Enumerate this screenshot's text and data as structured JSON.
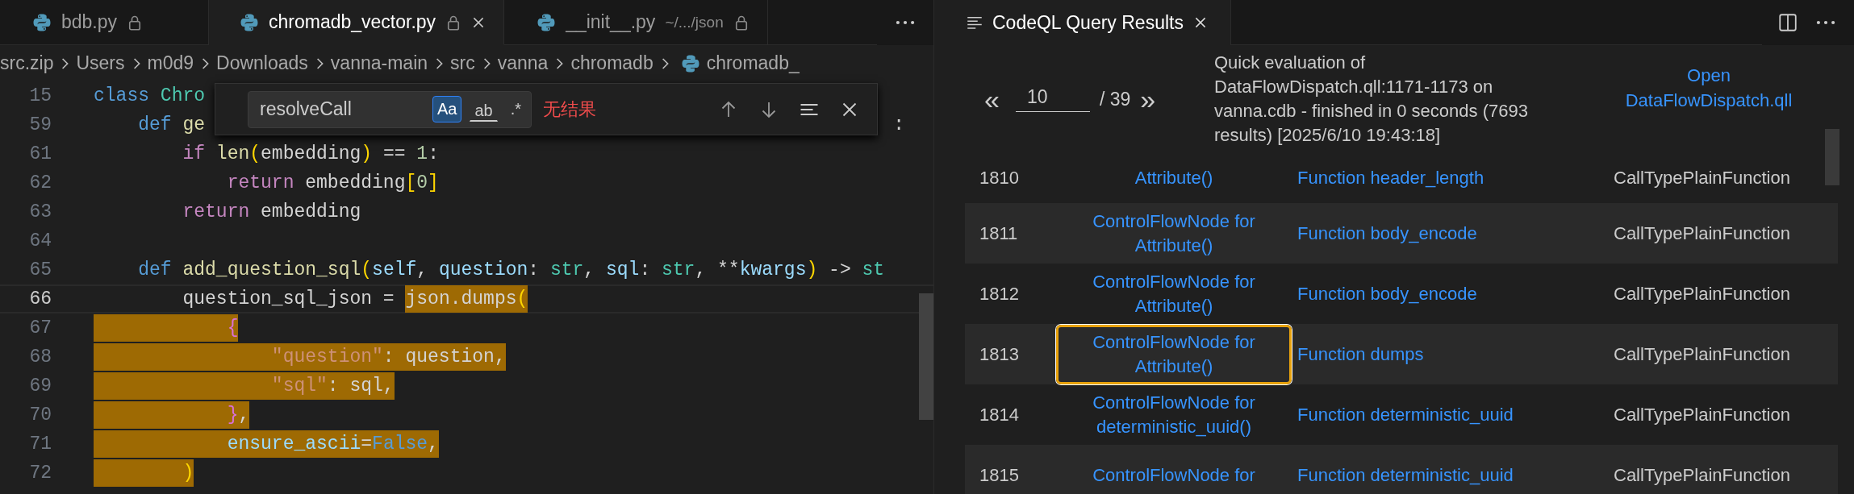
{
  "editor": {
    "tabs": [
      {
        "label": "bdb.py",
        "selected": false,
        "locked": true
      },
      {
        "label": "chromadb_vector.py",
        "selected": true,
        "locked": true
      },
      {
        "label": "__init__.py",
        "description": "~/.../json",
        "selected": false,
        "locked": true
      }
    ],
    "breadcrumb": [
      {
        "label": "src.zip",
        "kind": "folder"
      },
      {
        "label": "Users",
        "kind": "folder"
      },
      {
        "label": "m0d9",
        "kind": "folder"
      },
      {
        "label": "Downloads",
        "kind": "folder"
      },
      {
        "label": "vanna-main",
        "kind": "folder"
      },
      {
        "label": "src",
        "kind": "folder"
      },
      {
        "label": "vanna",
        "kind": "folder"
      },
      {
        "label": "chromadb",
        "kind": "folder"
      },
      {
        "label": "chromadb_",
        "kind": "file"
      }
    ],
    "find": {
      "value": "resolveCall",
      "options": [
        {
          "label": "Aa",
          "selected": true
        },
        {
          "label": "ab",
          "selected": false
        },
        {
          "label": ".*",
          "selected": false
        }
      ],
      "status": "无结果"
    },
    "lines": [
      {
        "number": "15",
        "active": false,
        "tokens": [
          {
            "text": "class ",
            "kind": "keyword",
            "hl": false
          },
          {
            "text": "Chro",
            "kind": "class",
            "hl": false
          }
        ]
      },
      {
        "number": "59",
        "active": false,
        "tail": ":",
        "tokens": [
          {
            "text": "    def ",
            "kind": "keyword",
            "hl": false
          },
          {
            "text": "ge",
            "kind": "function",
            "hl": false
          }
        ]
      },
      {
        "number": "61",
        "active": false,
        "tokens": [
          {
            "text": "        if ",
            "kind": "control",
            "hl": false
          },
          {
            "text": "len",
            "kind": "function",
            "hl": false
          },
          {
            "text": "(",
            "kind": "bracket",
            "hl": false
          },
          {
            "text": "embedding",
            "kind": "plain",
            "hl": false
          },
          {
            "text": ")",
            "kind": "bracket",
            "hl": false
          },
          {
            "text": " == ",
            "kind": "plain",
            "hl": false
          },
          {
            "text": "1",
            "kind": "number",
            "hl": false
          },
          {
            "text": ":",
            "kind": "plain",
            "hl": false
          }
        ]
      },
      {
        "number": "62",
        "active": false,
        "tokens": [
          {
            "text": "            return ",
            "kind": "control",
            "hl": false
          },
          {
            "text": "embedding",
            "kind": "plain",
            "hl": false
          },
          {
            "text": "[",
            "kind": "bracket",
            "hl": false
          },
          {
            "text": "0",
            "kind": "number",
            "hl": false
          },
          {
            "text": "]",
            "kind": "bracket",
            "hl": false
          }
        ]
      },
      {
        "number": "63",
        "active": false,
        "tokens": [
          {
            "text": "        return ",
            "kind": "control",
            "hl": false
          },
          {
            "text": "embedding",
            "kind": "plain",
            "hl": false
          }
        ]
      },
      {
        "number": "64",
        "active": false
      },
      {
        "number": "65",
        "active": false,
        "tokens": [
          {
            "text": "    def ",
            "kind": "keyword",
            "hl": false
          },
          {
            "text": "add_question_sql",
            "kind": "function",
            "hl": false
          },
          {
            "text": "(",
            "kind": "bracket",
            "hl": false
          },
          {
            "text": "self",
            "kind": "param",
            "hl": false
          },
          {
            "text": ", ",
            "kind": "plain",
            "hl": false
          },
          {
            "text": "question",
            "kind": "param",
            "hl": false
          },
          {
            "text": ": ",
            "kind": "plain",
            "hl": false
          },
          {
            "text": "str",
            "kind": "type",
            "hl": false
          },
          {
            "text": ", ",
            "kind": "plain",
            "hl": false
          },
          {
            "text": "sql",
            "kind": "param",
            "hl": false
          },
          {
            "text": ": ",
            "kind": "plain",
            "hl": false
          },
          {
            "text": "str",
            "kind": "type",
            "hl": false
          },
          {
            "text": ", **",
            "kind": "plain",
            "hl": false
          },
          {
            "text": "kwargs",
            "kind": "param",
            "hl": false
          },
          {
            "text": ")",
            "kind": "bracket",
            "hl": false
          },
          {
            "text": " -> ",
            "kind": "plain",
            "hl": false
          },
          {
            "text": "st",
            "kind": "type",
            "hl": false
          }
        ]
      },
      {
        "number": "66",
        "active": true,
        "tokens": [
          {
            "text": "        question_sql_json = ",
            "kind": "plain",
            "hl": false
          },
          {
            "text": "json.dumps",
            "kind": "plain",
            "hl": true
          },
          {
            "text": "(",
            "kind": "bracket",
            "hl": true
          }
        ]
      },
      {
        "number": "67",
        "active": false,
        "tokens": [
          {
            "text": "            {",
            "kind": "brace",
            "hl": true
          }
        ]
      },
      {
        "number": "68",
        "active": false,
        "tokens": [
          {
            "text": "                \"question\"",
            "kind": "string",
            "hl": true
          },
          {
            "text": ": question,",
            "kind": "plain",
            "hl": true
          }
        ]
      },
      {
        "number": "69",
        "active": false,
        "tokens": [
          {
            "text": "                \"sql\"",
            "kind": "string",
            "hl": true
          },
          {
            "text": ": sql,",
            "kind": "plain",
            "hl": true
          }
        ]
      },
      {
        "number": "70",
        "active": false,
        "tokens": [
          {
            "text": "            }",
            "kind": "brace",
            "hl": true
          },
          {
            "text": ",",
            "kind": "plain",
            "hl": true
          }
        ]
      },
      {
        "number": "71",
        "active": false,
        "tokens": [
          {
            "text": "            ensure_ascii",
            "kind": "param",
            "hl": true
          },
          {
            "text": "=",
            "kind": "plain",
            "hl": true
          },
          {
            "text": "False",
            "kind": "keyword",
            "hl": true
          },
          {
            "text": ",",
            "kind": "plain",
            "hl": true
          }
        ]
      },
      {
        "number": "72",
        "active": false,
        "tokens": [
          {
            "text": "        )",
            "kind": "bracket",
            "hl": true
          }
        ]
      }
    ]
  },
  "results": {
    "tab": "CodeQL Query Results",
    "prev": "«",
    "page": "10",
    "total": "/ 39",
    "next": "»",
    "description": "Quick evaluation of DataFlowDispatch.qll:1171-1173 on vanna.cdb - finished in 0 seconds (7693 results) [2025/6/10 19:43:18]",
    "open_link": "Open DataFlowDispatch.qll",
    "rows": [
      {
        "index": "1810",
        "node": "Attribute()",
        "function": "Function header_length",
        "call_type": "CallTypePlainFunction",
        "selected": false
      },
      {
        "index": "1811",
        "node": "ControlFlowNode for Attribute()",
        "function": "Function body_encode",
        "call_type": "CallTypePlainFunction",
        "selected": false
      },
      {
        "index": "1812",
        "node": "ControlFlowNode for Attribute()",
        "function": "Function body_encode",
        "call_type": "CallTypePlainFunction",
        "selected": false
      },
      {
        "index": "1813",
        "node": "ControlFlowNode for Attribute()",
        "function": "Function dumps",
        "call_type": "CallTypePlainFunction",
        "selected": true
      },
      {
        "index": "1814",
        "node": "ControlFlowNode for deterministic_uuid()",
        "function": "Function deterministic_uuid",
        "call_type": "CallTypePlainFunction",
        "selected": false
      },
      {
        "index": "1815",
        "node": "ControlFlowNode for",
        "function": "Function deterministic_uuid",
        "call_type": "CallTypePlainFunction",
        "selected": false
      }
    ]
  }
}
